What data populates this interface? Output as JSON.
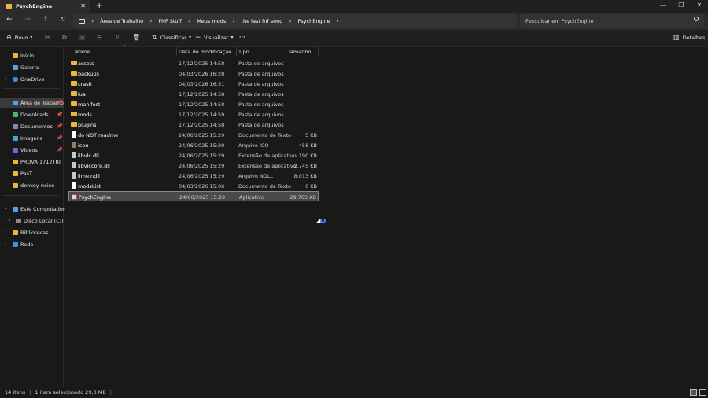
{
  "window": {
    "tab_title": "PsychEngine",
    "tab_close": "✕",
    "new_tab": "+",
    "minimize": "—",
    "maximize": "❐",
    "close": "✕"
  },
  "nav": {
    "back": "←",
    "forward": "→",
    "up": "↑",
    "refresh": "↻"
  },
  "breadcrumb": [
    "Área de Trabalho",
    "FNF Stuff",
    "Meus mods",
    "the last fnf song",
    "PsychEngine"
  ],
  "search": {
    "placeholder": "Pesquisar em PsychEngine"
  },
  "toolbar": {
    "new_label": "Novo",
    "sort_label": "Classificar",
    "view_label": "Visualizar",
    "more_label": "···",
    "details_label": "Detalhes"
  },
  "sidebar": {
    "items": [
      {
        "label": "Início",
        "icon": "home-icon"
      },
      {
        "label": "Galeria",
        "icon": "gallery-icon"
      },
      {
        "label": "OneDrive",
        "icon": "cloud-icon"
      },
      {
        "label": "Área de Trabalho",
        "icon": "desktop-icon"
      },
      {
        "label": "Downloads",
        "icon": "download-icon"
      },
      {
        "label": "Documentos",
        "icon": "documents-icon"
      },
      {
        "label": "Imagens",
        "icon": "pictures-icon"
      },
      {
        "label": "Vídeos",
        "icon": "videos-icon"
      },
      {
        "label": "PROVA 1712TRI",
        "icon": "folder-icon"
      },
      {
        "label": "PasT",
        "icon": "folder-icon"
      },
      {
        "label": "donkey-noise",
        "icon": "folder-icon"
      },
      {
        "label": "Este Computador",
        "icon": "computer-icon"
      },
      {
        "label": "Disco Local (C:)",
        "icon": "drive-icon"
      },
      {
        "label": "Bibliotecas",
        "icon": "libraries-icon"
      },
      {
        "label": "Rede",
        "icon": "network-icon"
      }
    ]
  },
  "columns": {
    "name": "Nome",
    "date": "Data de modificação",
    "type": "Tipo",
    "size": "Tamanho"
  },
  "files": [
    {
      "name": "assets",
      "date": "17/12/2025 14:58",
      "type": "Pasta de arquivos",
      "size": "",
      "kind": "folder"
    },
    {
      "name": "backups",
      "date": "04/03/2026 16:28",
      "type": "Pasta de arquivos",
      "size": "",
      "kind": "folder"
    },
    {
      "name": "crash",
      "date": "04/03/2026 16:31",
      "type": "Pasta de arquivos",
      "size": "",
      "kind": "folder"
    },
    {
      "name": "lua",
      "date": "17/12/2025 14:58",
      "type": "Pasta de arquivos",
      "size": "",
      "kind": "folder"
    },
    {
      "name": "manifest",
      "date": "17/12/2025 14:58",
      "type": "Pasta de arquivos",
      "size": "",
      "kind": "folder"
    },
    {
      "name": "mods",
      "date": "17/12/2025 14:59",
      "type": "Pasta de arquivos",
      "size": "",
      "kind": "folder"
    },
    {
      "name": "plugins",
      "date": "17/12/2025 14:58",
      "type": "Pasta de arquivos",
      "size": "",
      "kind": "folder"
    },
    {
      "name": "do NOT readme",
      "date": "24/06/2025 15:29",
      "type": "Documento de Texto",
      "size": "5 KB",
      "kind": "text"
    },
    {
      "name": "icon",
      "date": "24/06/2025 15:29",
      "type": "Arquivo ICO",
      "size": "458 KB",
      "kind": "ico"
    },
    {
      "name": "libvlc.dll",
      "date": "24/06/2025 15:29",
      "type": "Extensão de aplicativo",
      "size": "190 KB",
      "kind": "dll"
    },
    {
      "name": "libvlccore.dll",
      "date": "24/06/2025 15:29",
      "type": "Extensão de aplicativo",
      "size": "2.745 KB",
      "kind": "dll"
    },
    {
      "name": "lime.ndll",
      "date": "24/06/2025 15:29",
      "type": "Arquivo NDLL",
      "size": "8.013 KB",
      "kind": "dll"
    },
    {
      "name": "modsList",
      "date": "04/03/2026 15:06",
      "type": "Documento de Texto",
      "size": "0 KB",
      "kind": "text"
    },
    {
      "name": "PsychEngine",
      "date": "24/06/2025 15:29",
      "type": "Aplicativo",
      "size": "29.765 KB",
      "kind": "app"
    }
  ],
  "status": {
    "count": "14 itens",
    "selected": "1 item selecionado  29,0 MB"
  }
}
